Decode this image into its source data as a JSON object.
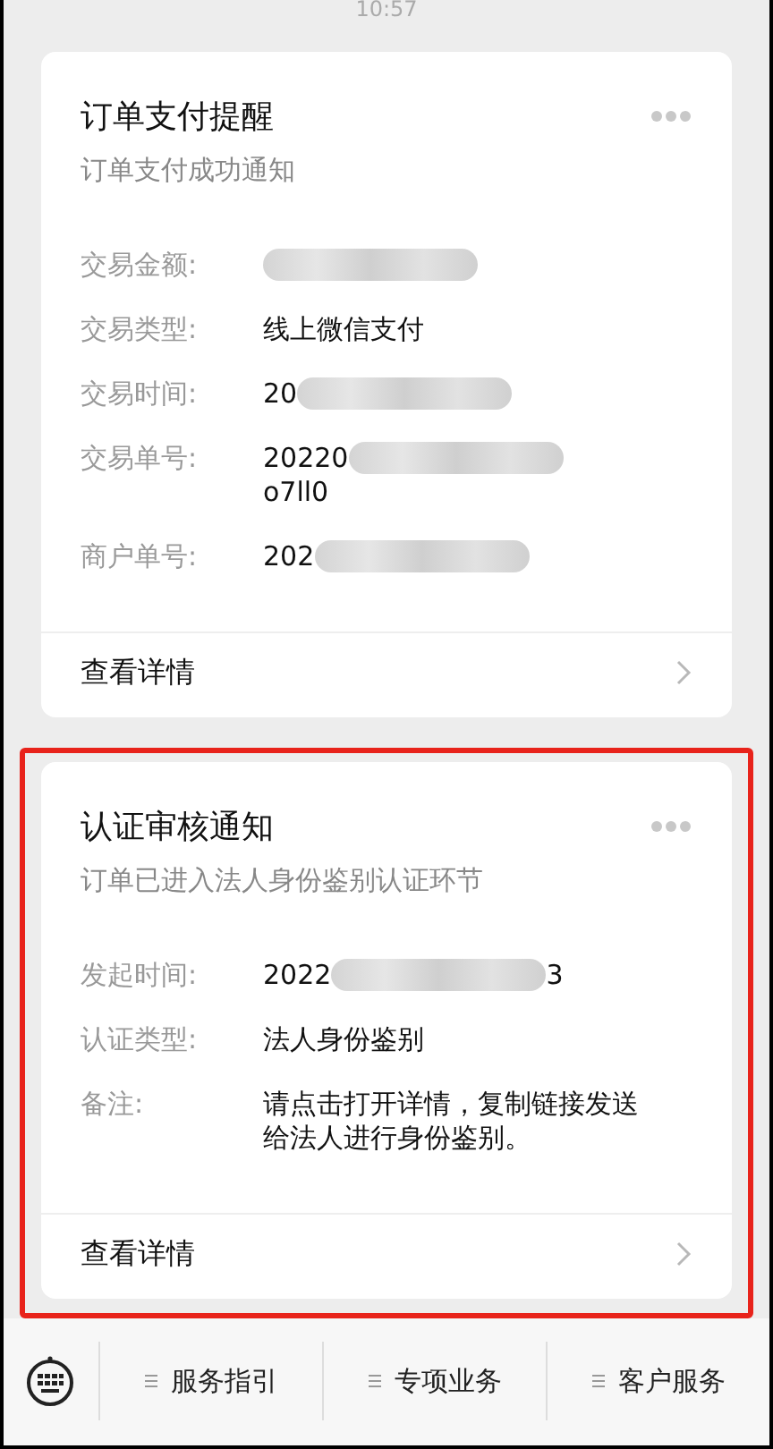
{
  "status_time": "10:57",
  "cards": [
    {
      "title": "订单支付提醒",
      "subtitle": "订单支付成功通知",
      "highlighted": false,
      "fields": [
        {
          "label": "交易金额:",
          "masked": true
        },
        {
          "label": "交易类型:",
          "value": "线上微信支付",
          "masked": false
        },
        {
          "label": "交易时间:",
          "value": "20",
          "masked": true
        },
        {
          "label": "交易单号:",
          "value": "20220",
          "masked": true,
          "continuation": "o7ll0"
        },
        {
          "label": "商户单号:",
          "value": "202",
          "masked": true
        }
      ],
      "link": "查看详情"
    },
    {
      "title": "认证审核通知",
      "subtitle": "订单已进入法人身份鉴别认证环节",
      "highlighted": true,
      "fields": [
        {
          "label": "发起时间:",
          "value": "2022",
          "masked": true,
          "suffix": "3"
        },
        {
          "label": "认证类型:",
          "value": "法人身份鉴别",
          "masked": false
        },
        {
          "label": "备注:",
          "value": "请点击打开详情，复制链接发送给法人进行身份鉴别。",
          "masked": false
        }
      ],
      "link": "查看详情"
    }
  ],
  "menu": [
    "服务指引",
    "专项业务",
    "客户服务"
  ]
}
